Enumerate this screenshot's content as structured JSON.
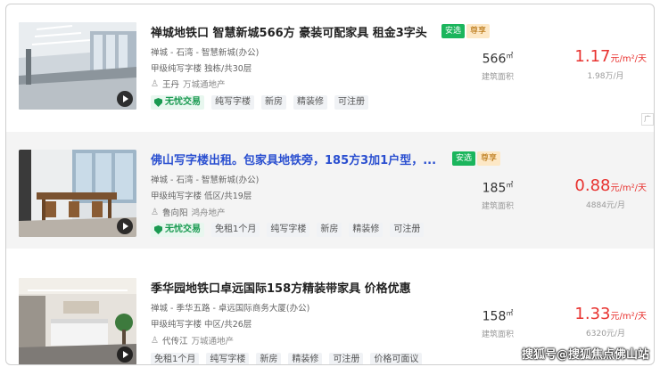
{
  "listings": [
    {
      "title": "禅城地铁口 智慧新城566方 豪装可配家具 租金3字头",
      "tag_green": "安选",
      "tag_orange": "尊享",
      "location": "禅城 - 石湾 - 智慧新城(办公)",
      "details": "甲级纯写字楼  独栋/共30层",
      "agent": "王丹",
      "company": "万城通地产",
      "chips": [
        "无忧交易",
        "纯写字楼",
        "新房",
        "精装修",
        "可注册"
      ],
      "area_value": "566",
      "area_unit": "㎡",
      "area_label": "建筑面积",
      "price_value": "1.17",
      "price_unit": "元/m²/天",
      "price_month": "1.98万/月"
    },
    {
      "title": "佛山写字楼出租。包家具地铁旁，185方3加1户型，...",
      "tag_green": "安选",
      "tag_orange": "尊享",
      "location": "禅城 - 石湾 - 智慧新城(办公)",
      "details": "甲级纯写字楼  低区/共19层",
      "agent": "鲁向阳",
      "company": "鸿舟地产",
      "chips": [
        "无忧交易",
        "免租1个月",
        "纯写字楼",
        "新房",
        "精装修",
        "可注册"
      ],
      "area_value": "185",
      "area_unit": "㎡",
      "area_label": "建筑面积",
      "price_value": "0.88",
      "price_unit": "元/m²/天",
      "price_month": "4884元/月"
    },
    {
      "title": "季华园地铁口卓远国际158方精装带家具 价格优惠",
      "location": "禅城 - 季华五路 - 卓远国际商务大厦(办公)",
      "details": "甲级纯写字楼  中区/共26层",
      "agent": "代传江",
      "company": "万城通地产",
      "chips": [
        "免租1个月",
        "纯写字楼",
        "新房",
        "精装修",
        "可注册",
        "价格可面议"
      ],
      "area_value": "158",
      "area_unit": "㎡",
      "area_label": "建筑面积",
      "price_value": "1.33",
      "price_unit": "元/m²/天",
      "price_month": "6320元/月"
    }
  ],
  "edge_mark": "广",
  "watermark": "搜狐号@搜狐焦点佛山站",
  "icons": {
    "play": "play-icon",
    "agent": "person-icon",
    "safe": "shield-icon"
  },
  "colors": {
    "price": "#e8322f",
    "link_title": "#2a4fd0",
    "safe_green": "#1a9a51",
    "tag_green": "#1bb55c"
  }
}
